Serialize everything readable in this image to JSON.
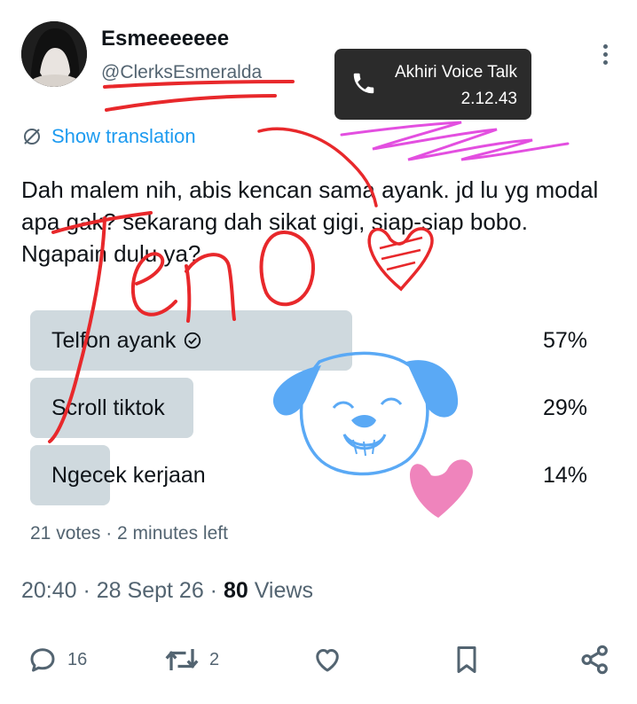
{
  "author": {
    "display_name": "Esmeeeeeee",
    "handle": "@ClerksEsmeralda"
  },
  "call_toast": {
    "title": "Akhiri Voice Talk",
    "duration": "2.12.43",
    "icon": "phone-icon"
  },
  "translate_label": "Show translation",
  "post_text": "Dah malem nih, abis kencan sama ayank. jd lu yg modal apa gak? sekarang dah sikat gigi, siap-siap bobo. Ngapain dulu ya?",
  "poll": {
    "options": [
      {
        "label": "Telfon ayank",
        "percent": "57%",
        "share": 0.57,
        "selected": true
      },
      {
        "label": "Scroll tiktok",
        "percent": "29%",
        "share": 0.29,
        "selected": false
      },
      {
        "label": "Ngecek kerjaan",
        "percent": "14%",
        "share": 0.14,
        "selected": false
      }
    ],
    "meta": "21 votes · 2 minutes left"
  },
  "timestamp": {
    "time": "20:40",
    "date": "28 Sept 26",
    "views_count": "80",
    "views_label": "Views"
  },
  "actions": {
    "replies": "16",
    "reposts": "2"
  },
  "colors": {
    "accent": "#1d9bf0",
    "poll_fill": "#cfd9de",
    "muted_text": "#536471",
    "scribble_red": "#e8282b",
    "scribble_blue": "#5aa9f5",
    "scribble_pink": "#ec6fb0",
    "scribble_magenta": "#e34fe0"
  },
  "doodle_text": "Jeno"
}
